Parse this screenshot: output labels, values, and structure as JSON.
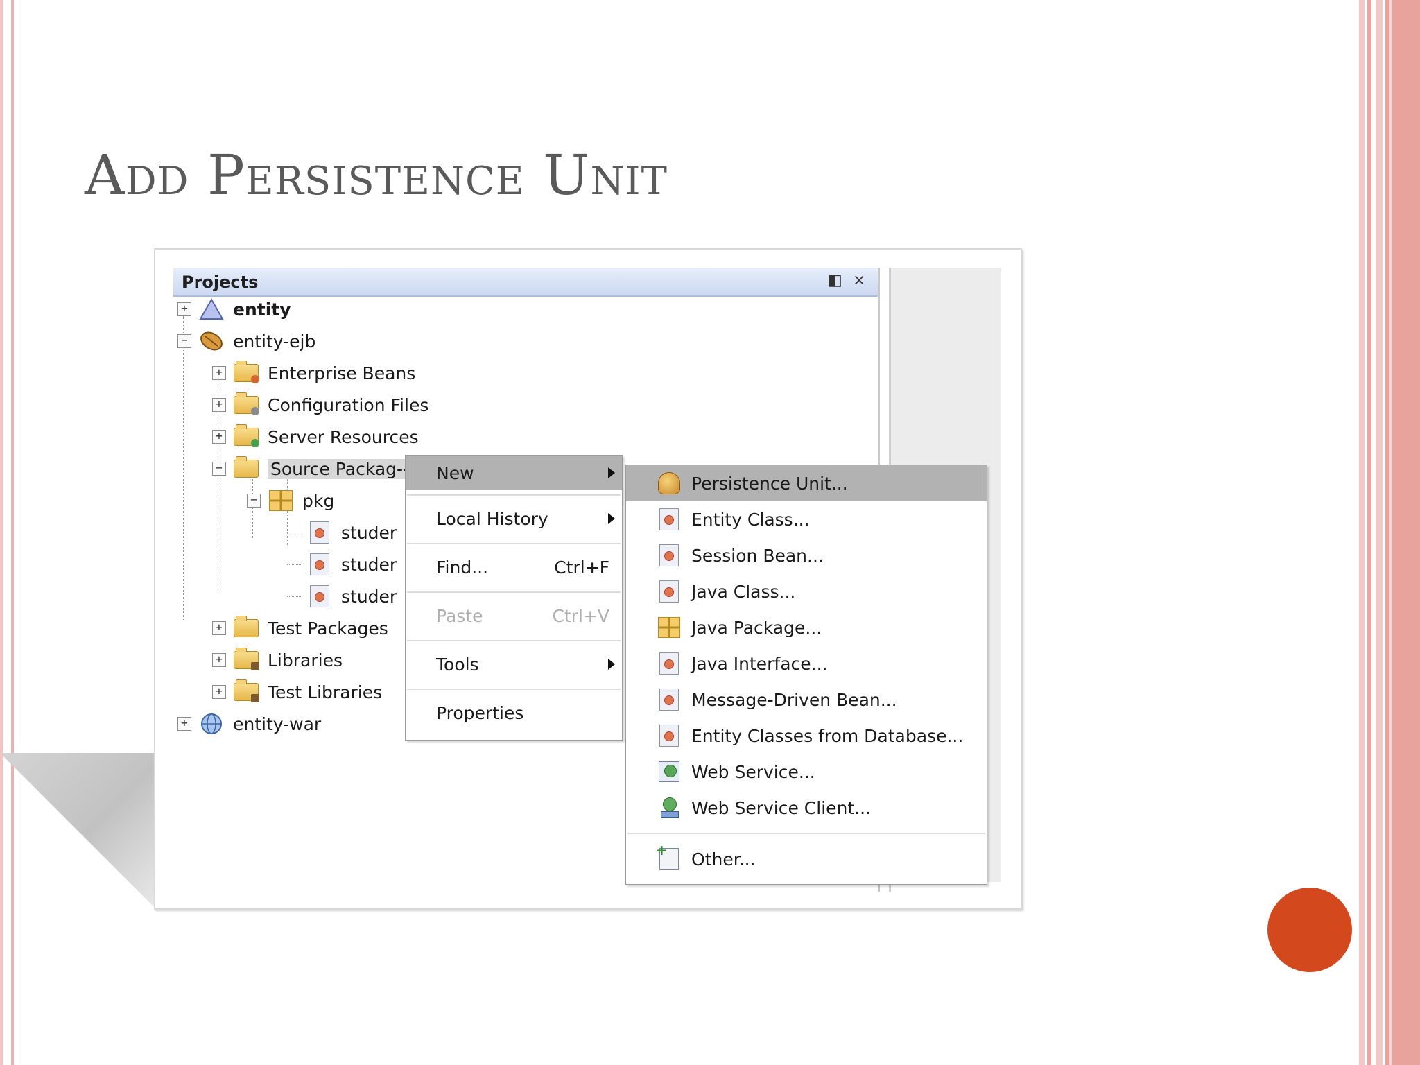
{
  "slide": {
    "title": "Add Persistence Unit"
  },
  "panel": {
    "title": "Projects",
    "minimize_glyph": "◧",
    "close_glyph": "×"
  },
  "tree": {
    "entity": "entity",
    "entity_ejb": "entity-ejb",
    "enterprise_beans": "Enterprise Beans",
    "configuration_files": "Configuration Files",
    "server_resources": "Server Resources",
    "source_packages": "Source Packag--",
    "pkg": "pkg",
    "student_1": "studer",
    "student_2": "studer",
    "student_3": "studer",
    "test_packages": "Test Packages",
    "libraries": "Libraries",
    "test_libraries": "Test Libraries",
    "entity_war": "entity-war",
    "expand_glyph": "+",
    "collapse_glyph": "−"
  },
  "context_menu": {
    "new": "New",
    "local_history": "Local History",
    "find": "Find...",
    "find_shortcut": "Ctrl+F",
    "paste": "Paste",
    "paste_shortcut": "Ctrl+V",
    "tools": "Tools",
    "properties": "Properties"
  },
  "new_submenu": {
    "persistence_unit": "Persistence Unit...",
    "entity_class": "Entity Class...",
    "session_bean": "Session Bean...",
    "java_class": "Java Class...",
    "java_package": "Java Package...",
    "java_interface": "Java Interface...",
    "message_driven_bean": "Message-Driven Bean...",
    "entity_classes_from_database": "Entity Classes from Database...",
    "web_service": "Web Service...",
    "web_service_client": "Web Service Client...",
    "other": "Other..."
  },
  "colors": {
    "accent_orange": "#d4481e",
    "border_pink": "#e7a39c",
    "menu_highlight": "#b2b2b2"
  }
}
